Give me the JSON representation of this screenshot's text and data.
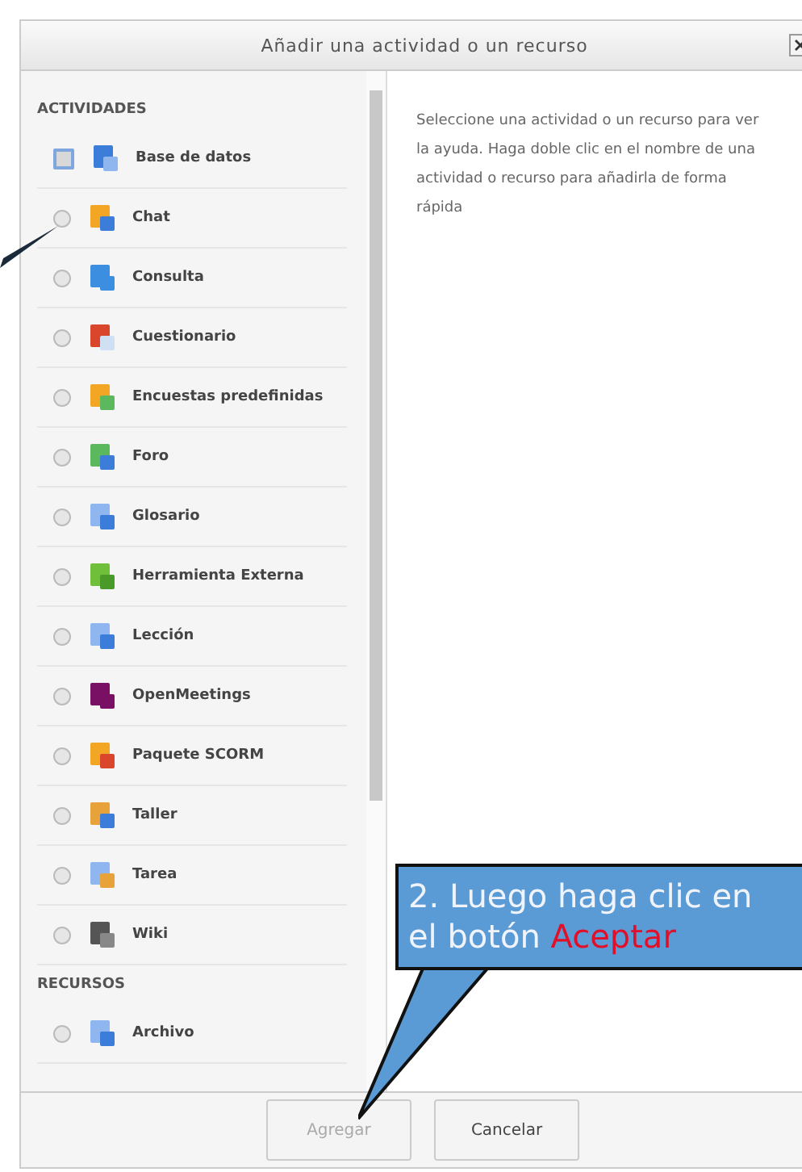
{
  "dialog": {
    "title": "Añadir una actividad o un recurso"
  },
  "sections": [
    {
      "heading": "ACTIVIDADES",
      "items": [
        {
          "label": "Base de datos",
          "focused": true
        },
        {
          "label": "Chat",
          "focused": false
        },
        {
          "label": "Consulta",
          "focused": false
        },
        {
          "label": "Cuestionario",
          "focused": false
        },
        {
          "label": "Encuestas predefinidas",
          "focused": false
        },
        {
          "label": "Foro",
          "focused": false
        },
        {
          "label": "Glosario",
          "focused": false
        },
        {
          "label": "Herramienta Externa",
          "focused": false
        },
        {
          "label": "Lección",
          "focused": false
        },
        {
          "label": "OpenMeetings",
          "focused": false
        },
        {
          "label": "Paquete SCORM",
          "focused": false
        },
        {
          "label": "Taller",
          "focused": false
        },
        {
          "label": "Tarea",
          "focused": false
        },
        {
          "label": "Wiki",
          "focused": false
        }
      ]
    },
    {
      "heading": "RECURSOS",
      "items": [
        {
          "label": "Archivo",
          "focused": false
        }
      ]
    }
  ],
  "help_text": "Seleccione una actividad o un recurso para ver la ayuda. Haga doble clic en el nombre de una actividad o recurso para añadirla de forma rápida",
  "buttons": [
    {
      "label": "Agregar",
      "disabled": true
    },
    {
      "label": "Cancelar",
      "disabled": false
    }
  ],
  "callout": {
    "text": "2. Luego haga clic en el botón",
    "highlight": "Aceptar"
  }
}
